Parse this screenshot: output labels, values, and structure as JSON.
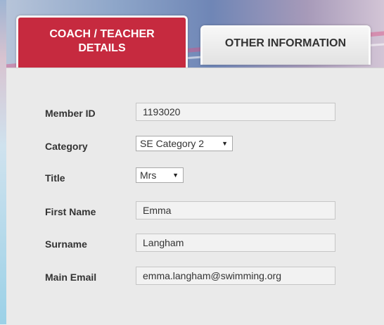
{
  "tabs": [
    {
      "label": "COACH / TEACHER DETAILS",
      "line1": "COACH / TEACHER",
      "line2": "DETAILS",
      "active": true
    },
    {
      "label": "OTHER INFORMATION",
      "active": false
    }
  ],
  "form": {
    "member_id": {
      "label": "Member ID",
      "value": "1193020"
    },
    "category": {
      "label": "Category",
      "selected": "SE Category 2"
    },
    "title": {
      "label": "Title",
      "selected": "Mrs"
    },
    "first_name": {
      "label": "First Name",
      "value": "Emma"
    },
    "surname": {
      "label": "Surname",
      "value": "Langham"
    },
    "main_email": {
      "label": "Main Email",
      "value": "emma.langham@swimming.org"
    }
  },
  "colors": {
    "active_tab": "#c62a3f",
    "inactive_tab": "#e6e6e6",
    "panel": "#eaeaea"
  },
  "icons": {
    "dropdown": "caret-down-icon"
  }
}
